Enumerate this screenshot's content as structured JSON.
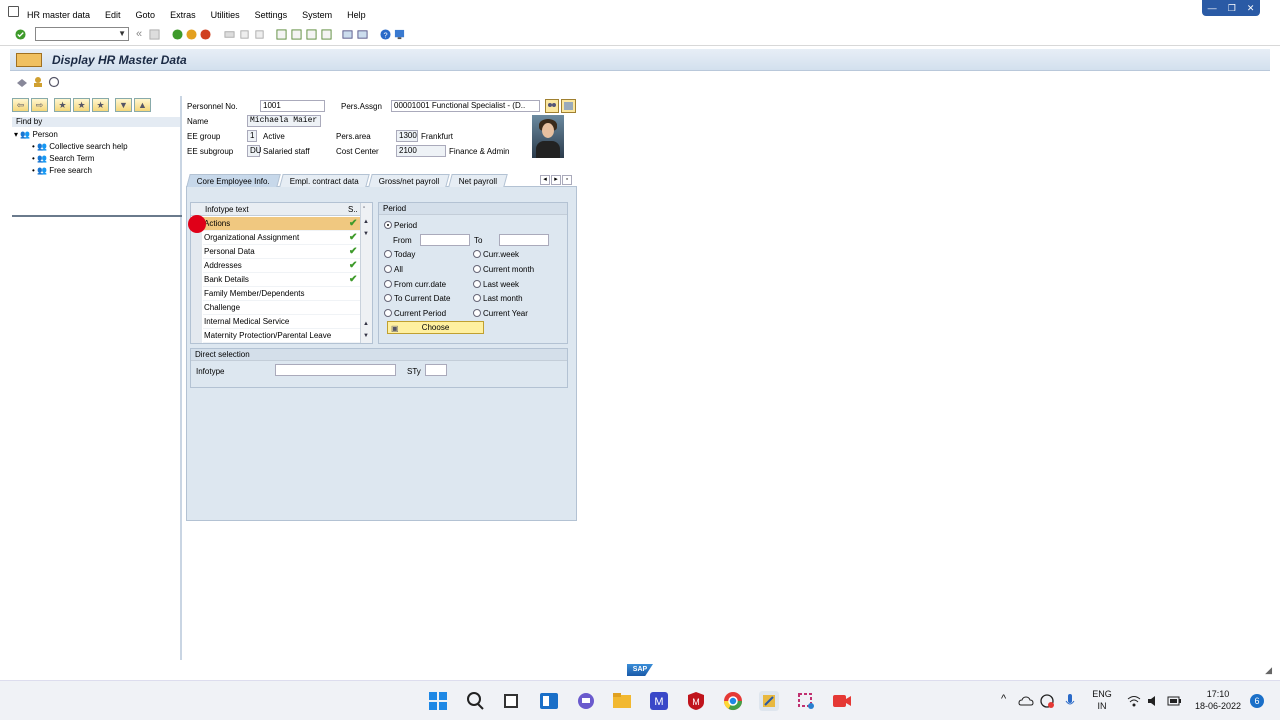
{
  "menu": [
    "HR master data",
    "Edit",
    "Goto",
    "Extras",
    "Utilities",
    "Settings",
    "System",
    "Help"
  ],
  "window_controls": [
    "—",
    "❐",
    "✕"
  ],
  "toolbar": {
    "back_label": "«"
  },
  "title": "Display HR Master Data",
  "findby": {
    "label": "Find by",
    "root": "Person",
    "items": [
      "Collective search help",
      "Search Term",
      "Free search"
    ]
  },
  "header": {
    "personnel_no_label": "Personnel No.",
    "personnel_no": "1001",
    "pers_assgn_label": "Pers.Assgn",
    "pers_assgn": "00001001 Functional Specialist - (D..",
    "name_label": "Name",
    "name": "Michaela Maier",
    "ee_group_label": "EE group",
    "ee_group_code": "1",
    "ee_group_text": "Active",
    "pers_area_label": "Pers.area",
    "pers_area_code": "1300",
    "pers_area_text": "Frankfurt",
    "ee_subgroup_label": "EE subgroup",
    "ee_subgroup_code": "DU",
    "ee_subgroup_text": "Salaried staff",
    "cost_center_label": "Cost Center",
    "cost_center_code": "2100",
    "cost_center_text": "Finance & Admin"
  },
  "tabs": [
    "Core Employee Info.",
    "Empl. contract data",
    "Gross/net payroll",
    "Net payroll"
  ],
  "infotype_table": {
    "col_text": "Infotype text",
    "col_status": "S..",
    "rows": [
      {
        "text": "Actions",
        "check": "✔"
      },
      {
        "text": "Organizational Assignment",
        "check": "✔"
      },
      {
        "text": "Personal Data",
        "check": "✔"
      },
      {
        "text": "Addresses",
        "check": "✔"
      },
      {
        "text": "Bank Details",
        "check": "✔"
      },
      {
        "text": "Family Member/Dependents",
        "check": ""
      },
      {
        "text": "Challenge",
        "check": ""
      },
      {
        "text": "Internal Medical Service",
        "check": ""
      },
      {
        "text": "Maternity Protection/Parental Leave",
        "check": ""
      }
    ]
  },
  "period": {
    "title": "Period",
    "period_label": "Period",
    "from_label": "From",
    "to_label": "To",
    "today": "Today",
    "curr_week": "Curr.week",
    "all": "All",
    "current_month": "Current month",
    "from_curr_date": "From curr.date",
    "last_week": "Last week",
    "to_current_date": "To Current Date",
    "last_month": "Last month",
    "current_period": "Current Period",
    "current_year": "Current Year",
    "choose": "Choose"
  },
  "direct": {
    "title": "Direct selection",
    "infotype_label": "Infotype",
    "sty_label": "STy"
  },
  "sap_logo": "SAP",
  "tray": {
    "lang1": "ENG",
    "lang2": "IN",
    "time": "17:10",
    "date": "18-06-2022",
    "badge": "6"
  },
  "colors": {
    "accent": "#2a5aa5",
    "selected_row": "#f0c880",
    "check": "#3e9a2a",
    "choose_btn": "#fff0a0"
  }
}
